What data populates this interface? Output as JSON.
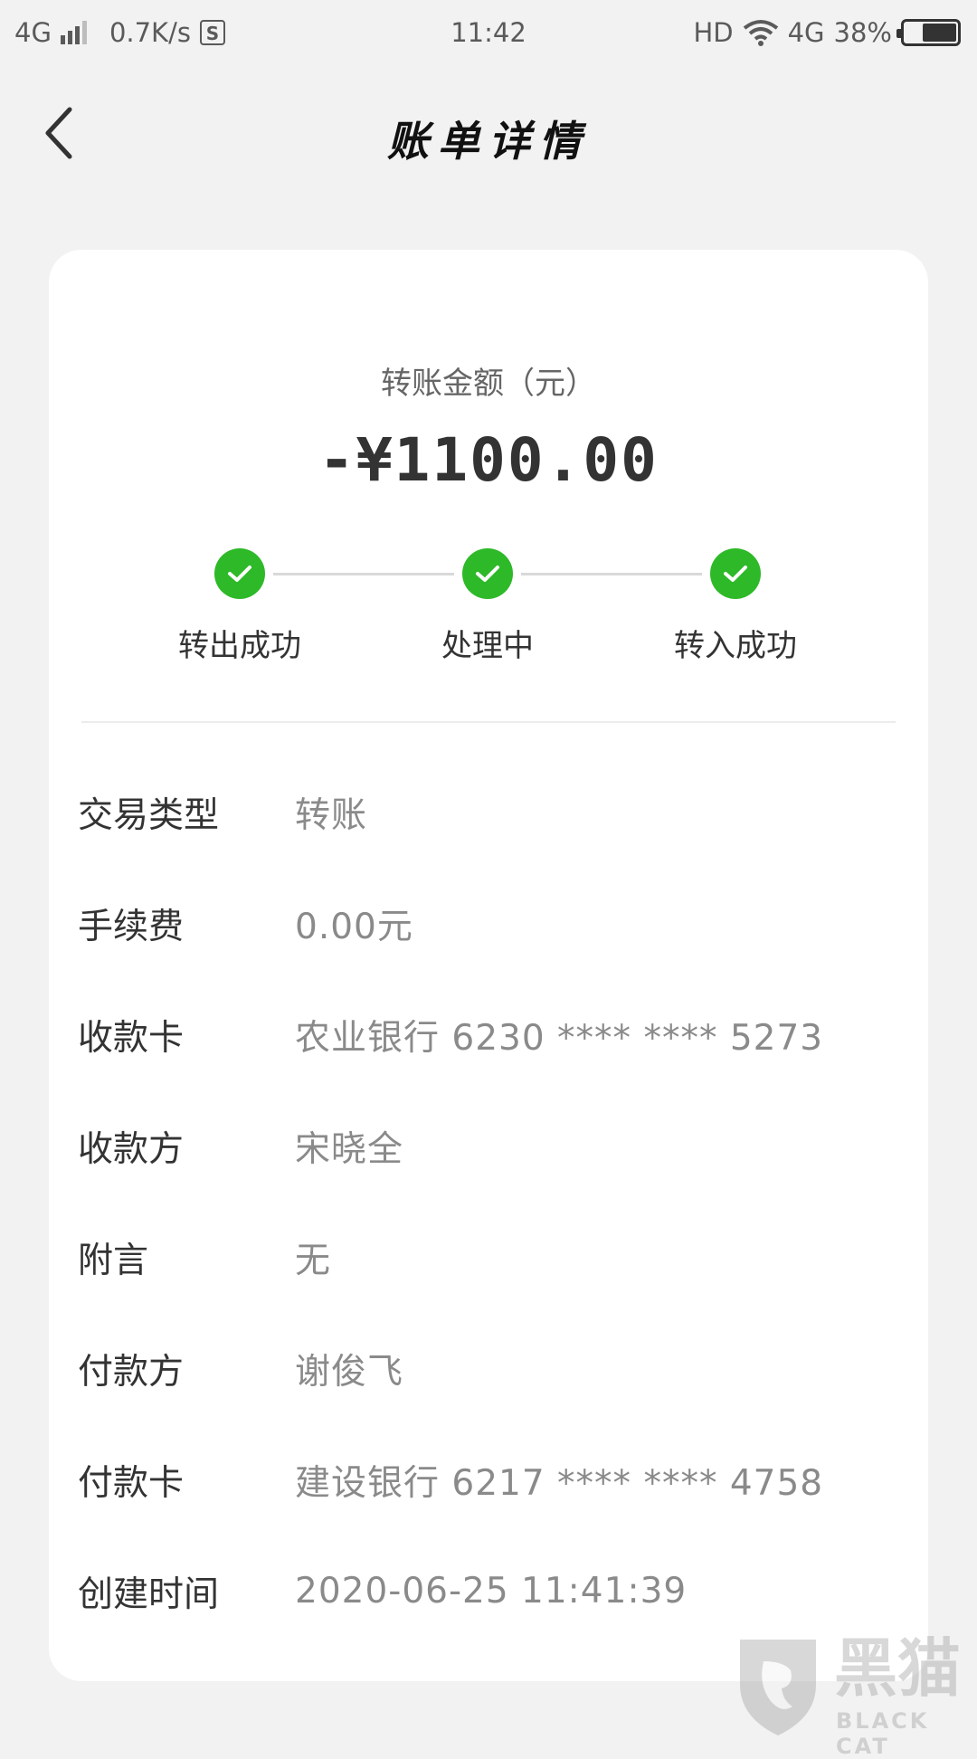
{
  "status_bar": {
    "network": "4G",
    "speed": "0.7K/s",
    "badge": "S",
    "time": "11:42",
    "hd": "HD",
    "network2": "4G",
    "battery": "38%"
  },
  "nav": {
    "title": "账单详情",
    "back_icon": "chevron-left-icon"
  },
  "summary": {
    "amount_label": "转账金额（元）",
    "amount": "-¥1100.00"
  },
  "steps": [
    {
      "label": "转出成功",
      "done": true
    },
    {
      "label": "处理中",
      "done": true
    },
    {
      "label": "转入成功",
      "done": true
    }
  ],
  "details": [
    {
      "key": "交易类型",
      "value": "转账"
    },
    {
      "key": "手续费",
      "value": "0.00元"
    },
    {
      "key": "收款卡",
      "value": "农业银行  6230  ****  ****  5273"
    },
    {
      "key": "收款方",
      "value": "宋晓全"
    },
    {
      "key": "附言",
      "value": "无"
    },
    {
      "key": "付款方",
      "value": "谢俊飞"
    },
    {
      "key": "付款卡",
      "value": "建设银行  6217  ****  ****  4758"
    },
    {
      "key": "创建时间",
      "value": "2020-06-25  11:41:39"
    }
  ],
  "watermark": {
    "text": "黑猫",
    "sub": "BLACK CAT"
  },
  "colors": {
    "success": "#2db928",
    "background": "#f2f2f2",
    "card": "#ffffff"
  }
}
